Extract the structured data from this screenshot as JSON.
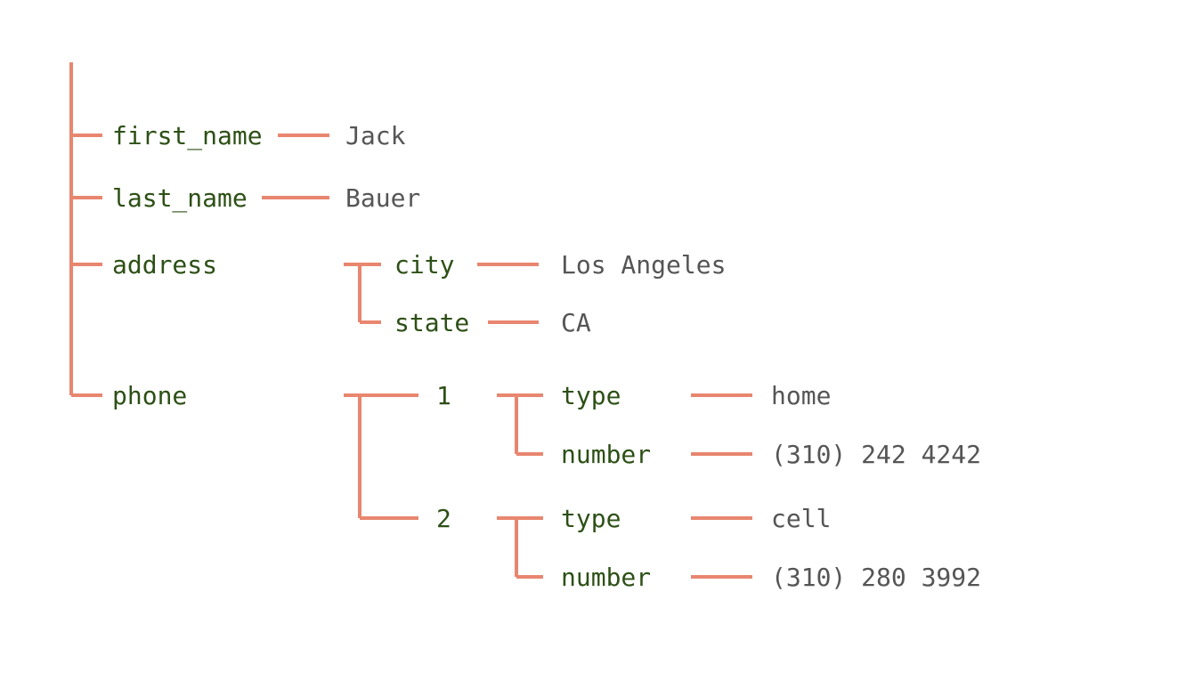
{
  "keys": {
    "first_name": "first_name",
    "last_name": "last_name",
    "address": "address",
    "city": "city",
    "state": "state",
    "phone": "phone",
    "phone1": "1",
    "phone2": "2",
    "type": "type",
    "number": "number"
  },
  "values": {
    "first_name": "Jack",
    "last_name": "Bauer",
    "city": "Los Angeles",
    "state": "CA",
    "phone1_type": "home",
    "phone1_number": "(310) 242 4242",
    "phone2_type": "cell",
    "phone2_number": "(310) 280 3992"
  },
  "colors": {
    "branch": "#e8866f",
    "key": "#2d5016",
    "value": "#555555"
  }
}
